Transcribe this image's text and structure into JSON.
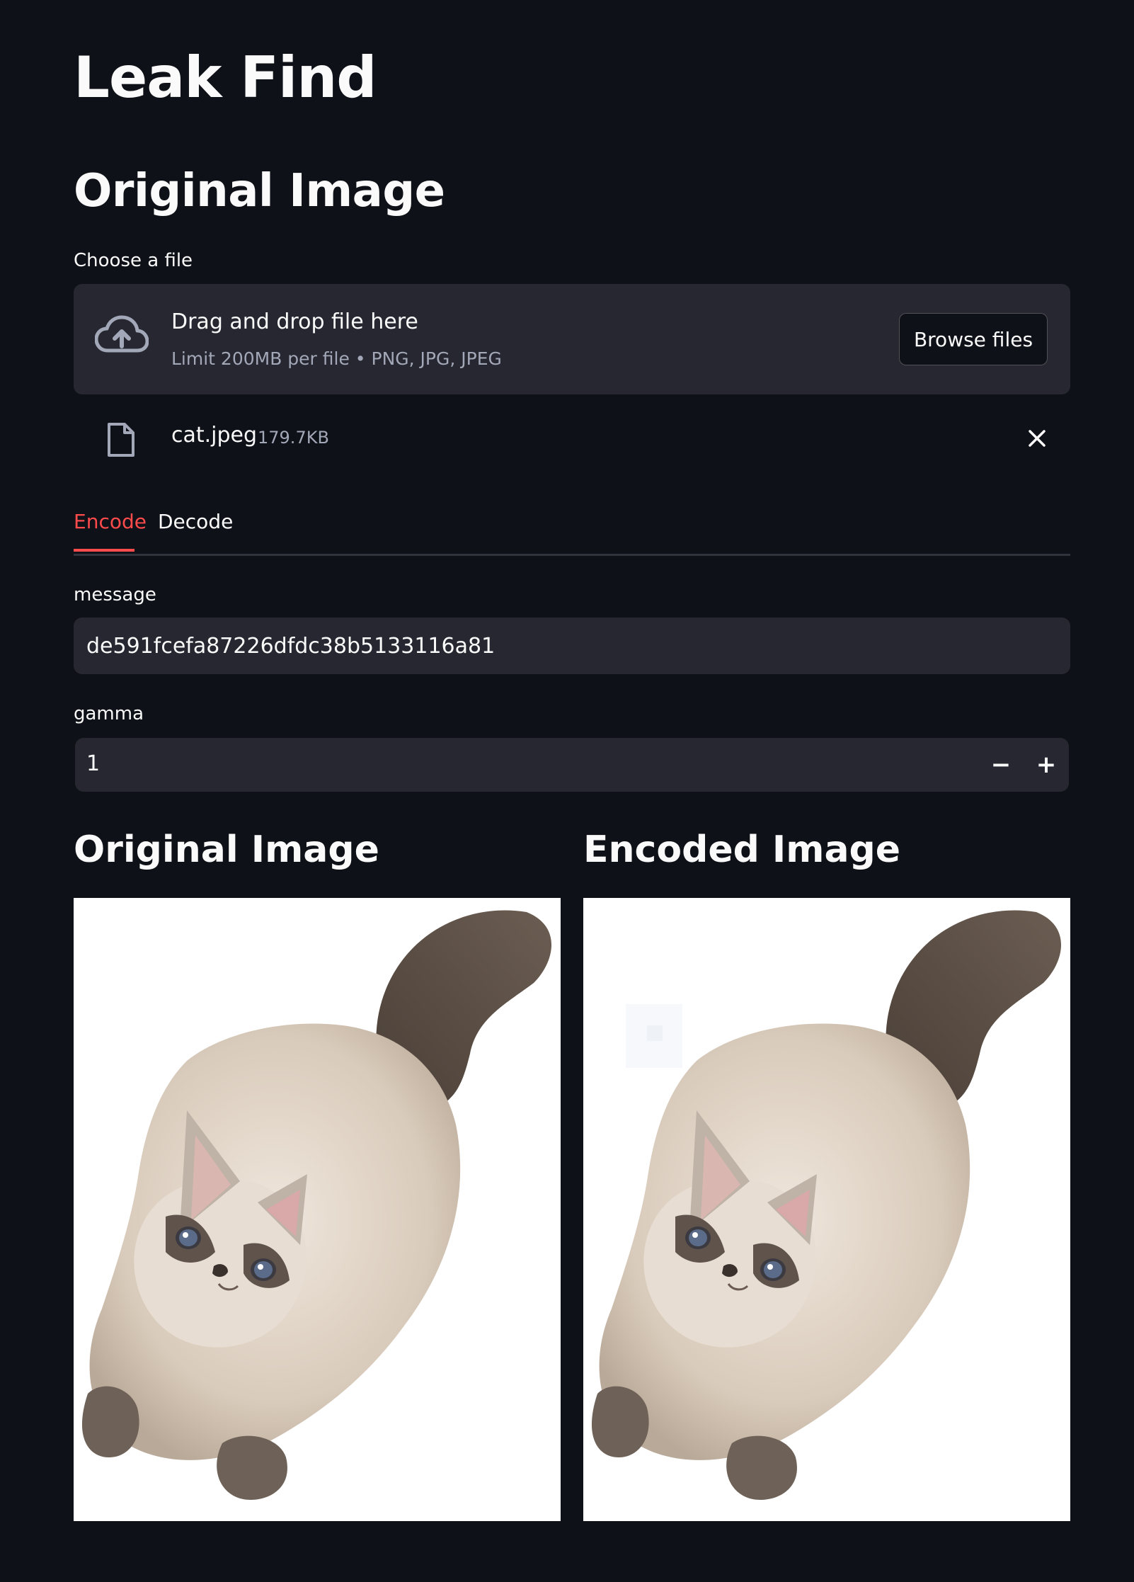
{
  "app": {
    "title": "Leak Find"
  },
  "upload_section": {
    "title": "Original Image",
    "label": "Choose a file",
    "dropzone": {
      "icon": "cloud-upload-icon",
      "main_text": "Drag and drop file here",
      "sub_text": "Limit 200MB per file • PNG, JPG, JPEG",
      "browse_label": "Browse files"
    },
    "uploaded_file": {
      "icon": "file-icon",
      "name": "cat.jpeg",
      "size": "179.7KB",
      "remove_icon": "close-icon"
    }
  },
  "tabs": [
    {
      "label": "Encode",
      "active": true
    },
    {
      "label": "Decode",
      "active": false
    }
  ],
  "message_field": {
    "label": "message",
    "value": "de591fcefa87226dfdc38b5133116a81"
  },
  "gamma_field": {
    "label": "gamma",
    "value": "1",
    "decrement": "−",
    "increment": "+"
  },
  "results": {
    "original_title": "Original Image",
    "encoded_title": "Encoded Image"
  },
  "colors": {
    "background": "#0e1117",
    "surface": "#262730",
    "accent": "#ff4b4b",
    "text": "#fafafa",
    "muted_text": "#a3a8b8"
  }
}
